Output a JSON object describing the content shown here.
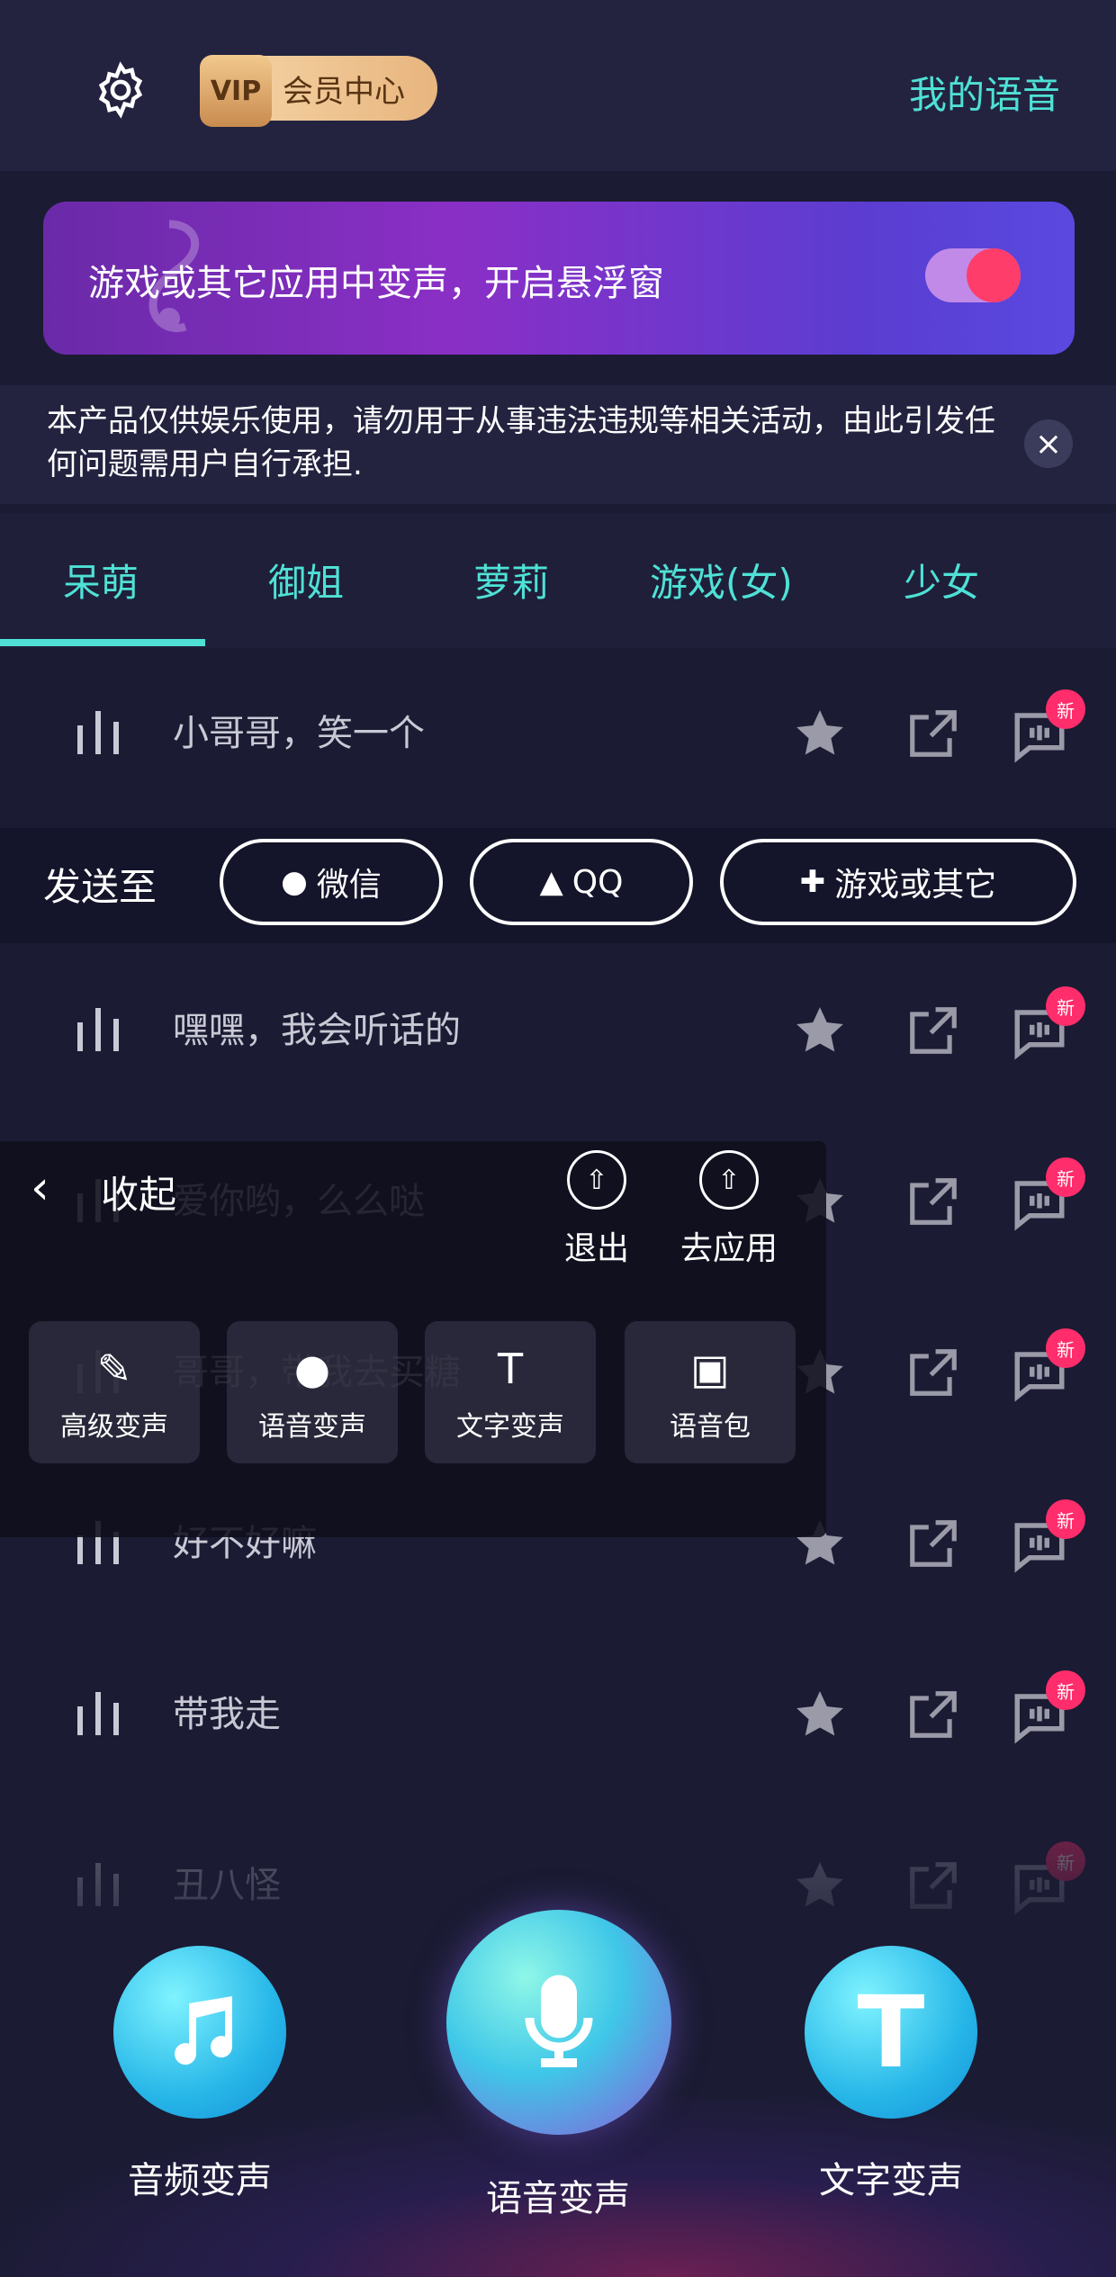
{
  "header": {
    "vip_badge": "VIP",
    "vip_label": "会员中心",
    "my_voice": "我的语音"
  },
  "banner": {
    "text": "游戏或其它应用中变声，开启悬浮窗",
    "toggle_on": true
  },
  "notice": {
    "text": "本产品仅供娱乐使用，请勿用于从事违法违规等相关活动，由此引发任何问题需用户自行承担.",
    "close_icon": "×"
  },
  "tabs": [
    "呆萌",
    "御姐",
    "萝莉",
    "游戏(女)",
    "少女"
  ],
  "active_tab": 0,
  "list": [
    {
      "label": "小哥哥，笑一个"
    },
    {
      "label": "嘿嘿，我会听话的"
    },
    {
      "label": "爱你哟，么么哒"
    },
    {
      "label": "哥哥，带我去买糖"
    },
    {
      "label": "好不好嘛"
    },
    {
      "label": "带我走"
    },
    {
      "label": "丑八怪"
    }
  ],
  "new_badge": "新",
  "send": {
    "label": "发送至",
    "wechat": "微信",
    "qq": "QQ",
    "other": "游戏或其它"
  },
  "overlay": {
    "collapse": "收起",
    "exit": "退出",
    "apply": "去应用",
    "advanced": "高级变声",
    "voice_change": "语音变声",
    "text_change": "文字变声",
    "voice_pack": "语音包"
  },
  "bottom": {
    "audio": "音频变声",
    "voice": "语音变声",
    "text": "文字变声",
    "text_icon_letter": "T"
  },
  "colors": {
    "accent": "#4fe1d5",
    "badge": "#ff2d6b",
    "background": "#1b1b33"
  }
}
